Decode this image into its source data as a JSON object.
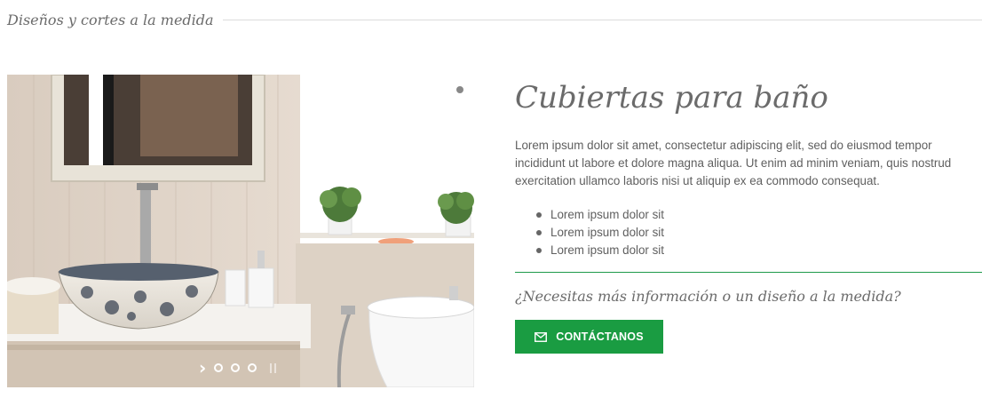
{
  "section": {
    "title": "Diseños y cortes a la medida"
  },
  "slider": {
    "next_icon": "chevron-right-icon",
    "pause_icon": "pause-icon",
    "dot_count": 3
  },
  "product": {
    "title": "Cubiertas para baño",
    "description": "Lorem ipsum dolor sit amet, consectetur adipiscing elit, sed do eiusmod tempor incididunt ut labore et dolore magna aliqua. Ut enim ad minim veniam, quis nostrud exercitation ullamco laboris nisi ut aliquip ex ea commodo consequat.",
    "features": [
      "Lorem ipsum dolor sit",
      "Lorem ipsum dolor sit",
      "Lorem ipsum dolor sit"
    ]
  },
  "cta": {
    "question": "¿Necesitas más información o un diseño a la medida?",
    "button_label": "CONTÁCTANOS",
    "button_icon": "envelope-icon"
  },
  "colors": {
    "accent": "#1a9c42",
    "divider": "#1e9a4a",
    "text": "#666666"
  }
}
